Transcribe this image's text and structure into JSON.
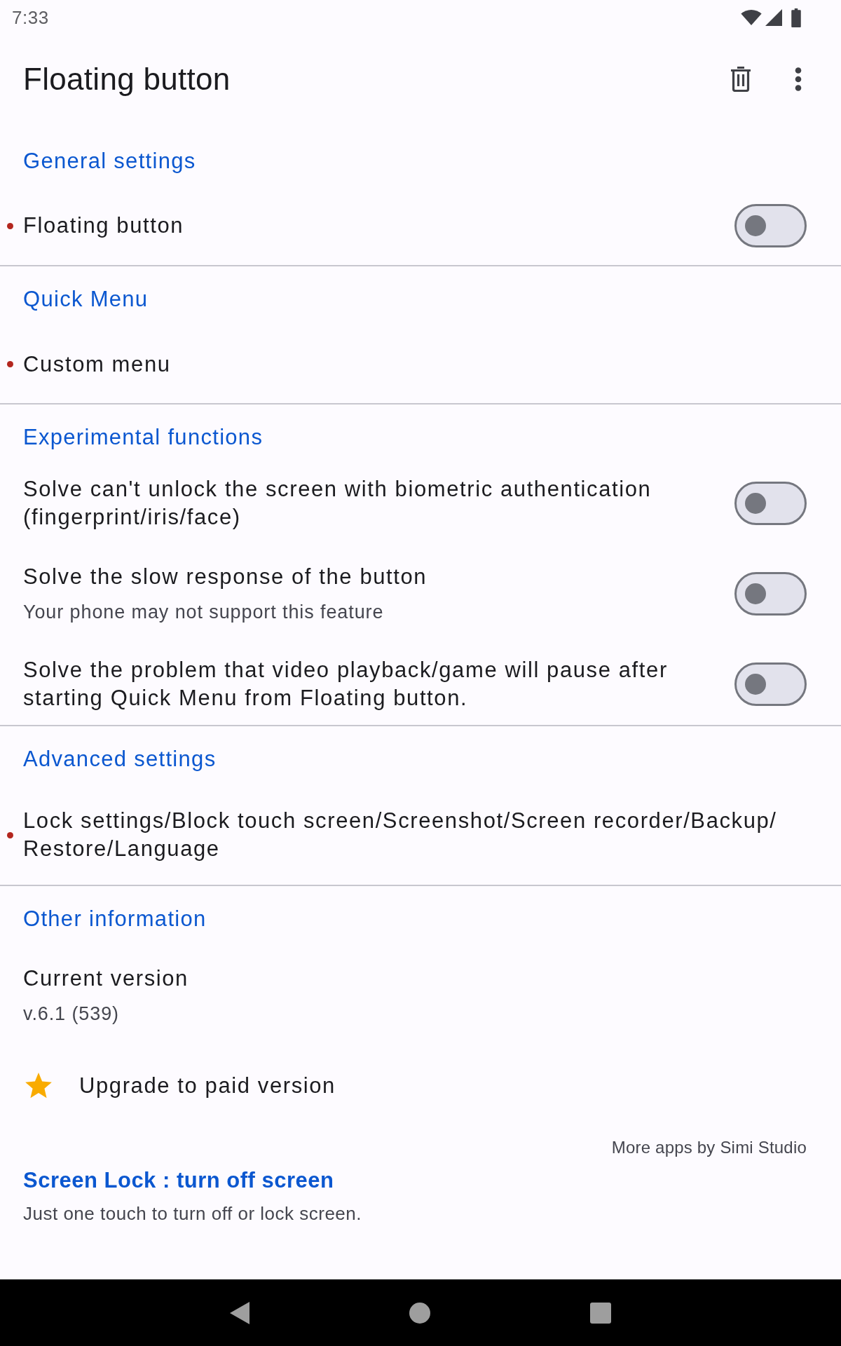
{
  "status_bar": {
    "time": "7:33"
  },
  "app_bar": {
    "title": "Floating button"
  },
  "sections": [
    {
      "header": "General settings",
      "items": [
        {
          "kind": "switch",
          "title": "Floating button",
          "dot": true,
          "on": false
        }
      ]
    },
    {
      "header": "Quick Menu",
      "items": [
        {
          "kind": "link",
          "title": "Custom menu",
          "dot": true
        }
      ]
    },
    {
      "header": "Experimental functions",
      "items": [
        {
          "kind": "switch",
          "title": "Solve can't unlock the screen with biometric authentication (fingerprint/iris/face)",
          "dot": false,
          "on": false
        },
        {
          "kind": "switch",
          "title": "Solve the slow response of the button",
          "subtitle": "Your phone may not support this feature",
          "dot": false,
          "on": false
        },
        {
          "kind": "switch",
          "title": "Solve the problem that video playback/game will pause after starting Quick Menu from Floating button.",
          "dot": false,
          "on": false
        }
      ]
    },
    {
      "header": "Advanced settings",
      "items": [
        {
          "kind": "link",
          "title": "Lock settings/Block touch screen/Screenshot/Screen recorder/Backup/Restore/Language",
          "dot": true
        }
      ]
    },
    {
      "header": "Other information",
      "items": [
        {
          "kind": "info",
          "title": "Current version",
          "subtitle": "v.6.1 (539)",
          "dot": false
        },
        {
          "kind": "upgrade",
          "title": "Upgrade to paid version",
          "dot": false
        }
      ]
    }
  ],
  "promo": {
    "label": "More apps by Simi Studio",
    "title": "Screen Lock : turn off screen",
    "description": "Just one touch to turn off or lock screen."
  }
}
